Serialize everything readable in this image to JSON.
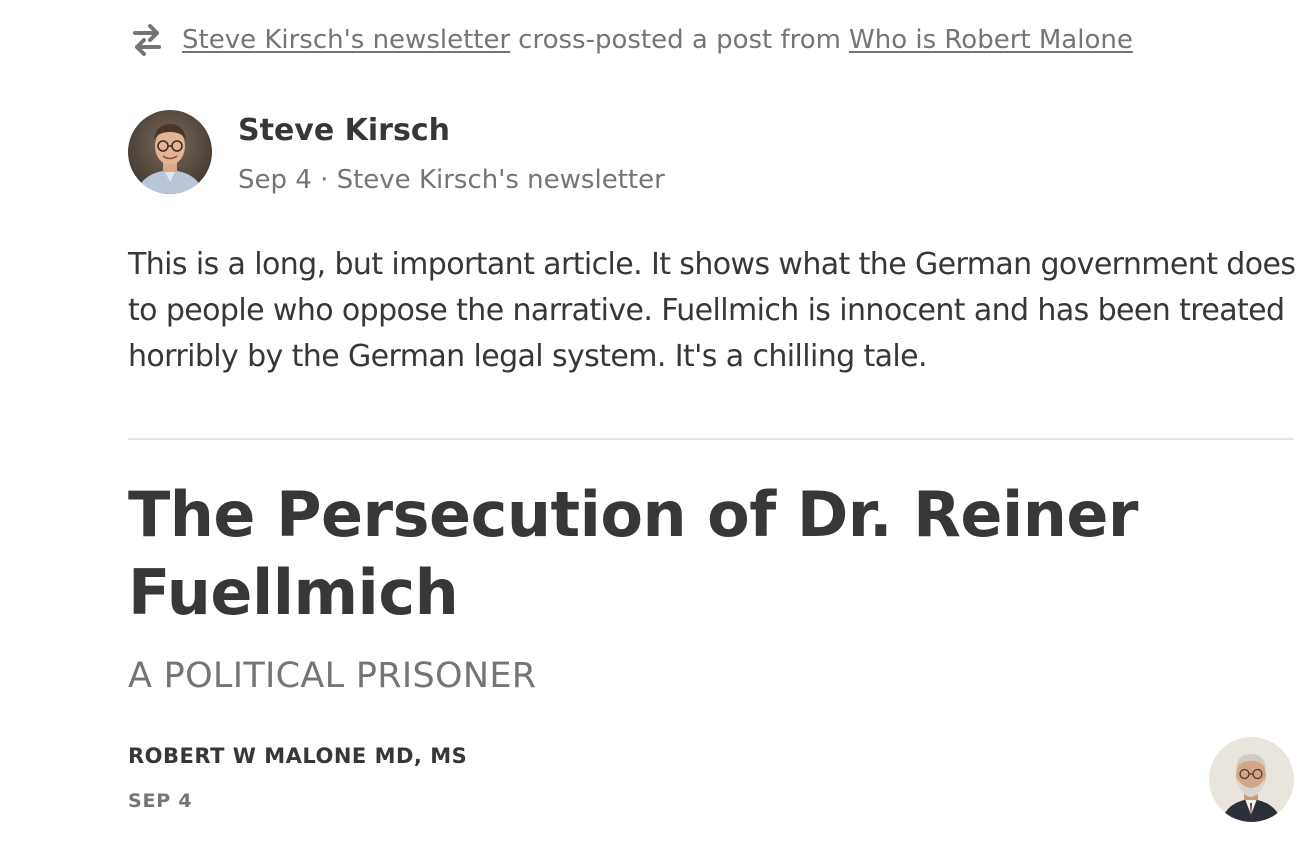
{
  "crosspost": {
    "icon": "repost-arrows-icon",
    "source_newsletter": "Steve Kirsch's newsletter",
    "middle_text": "cross-posted a post from",
    "origin_publication": "Who is Robert Malone"
  },
  "author": {
    "name": "Steve Kirsch",
    "meta": "Sep 4 · Steve Kirsch's newsletter"
  },
  "comment": {
    "text": "This is a long, but important article. It shows what the German government does to people who oppose the narrative. Fuellmich is innocent and has been treated horribly by the German legal system. It's a chilling tale."
  },
  "post": {
    "title": "The Persecution of Dr. Reiner Fuellmich",
    "subtitle": "A POLITICAL PRISONER",
    "byline": "ROBERT W MALONE MD, MS",
    "date": "SEP 4"
  },
  "colors": {
    "text_primary": "#363737",
    "text_secondary": "#757575",
    "divider": "#e5e5e5"
  }
}
